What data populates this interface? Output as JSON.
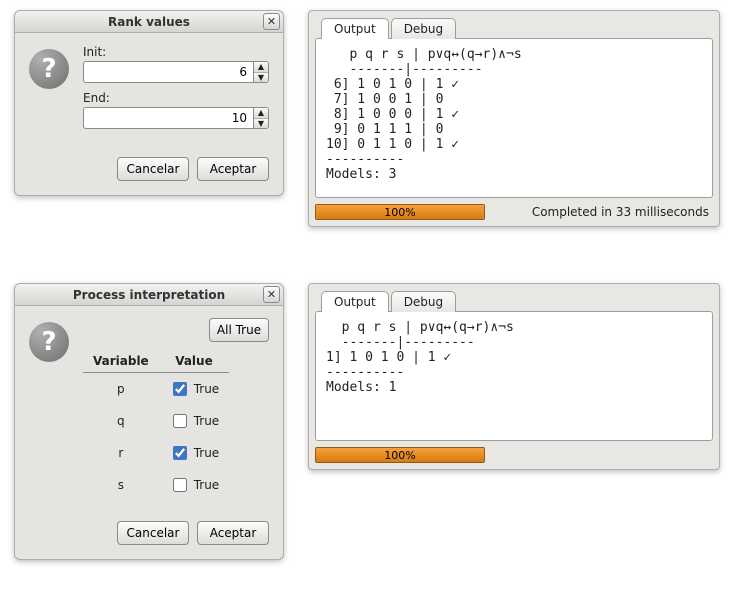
{
  "rank_dialog": {
    "title": "Rank values",
    "close_glyph": "✕",
    "init_label": "Init:",
    "init_value": "6",
    "end_label": "End:",
    "end_value": "10",
    "cancel_label": "Cancelar",
    "accept_label": "Aceptar"
  },
  "pi_dialog": {
    "title": "Process interpretation",
    "close_glyph": "✕",
    "alltrue_label": "All True",
    "col_variable": "Variable",
    "col_value": "Value",
    "vars": [
      {
        "name": "p",
        "checked": true,
        "text": "True"
      },
      {
        "name": "q",
        "checked": false,
        "text": "True"
      },
      {
        "name": "r",
        "checked": true,
        "text": "True"
      },
      {
        "name": "s",
        "checked": false,
        "text": "True"
      }
    ],
    "cancel_label": "Cancelar",
    "accept_label": "Aceptar"
  },
  "panel1": {
    "tabs": {
      "output": "Output",
      "debug": "Debug"
    },
    "content": "   p q r s | p∨q↔(q→r)∧¬s\n   -------|---------\n 6] 1 0 1 0 | 1 ✓\n 7] 1 0 0 1 | 0\n 8] 1 0 0 0 | 1 ✓\n 9] 0 1 1 1 | 0\n10] 0 1 1 0 | 1 ✓\n----------\nModels: 3",
    "progress_pct": "100%",
    "status": "Completed in 33 milliseconds"
  },
  "panel2": {
    "tabs": {
      "output": "Output",
      "debug": "Debug"
    },
    "content": "  p q r s | p∨q↔(q→r)∧¬s\n  -------|---------\n1] 1 0 1 0 | 1 ✓\n----------\nModels: 1",
    "progress_pct": "100%",
    "status": ""
  }
}
